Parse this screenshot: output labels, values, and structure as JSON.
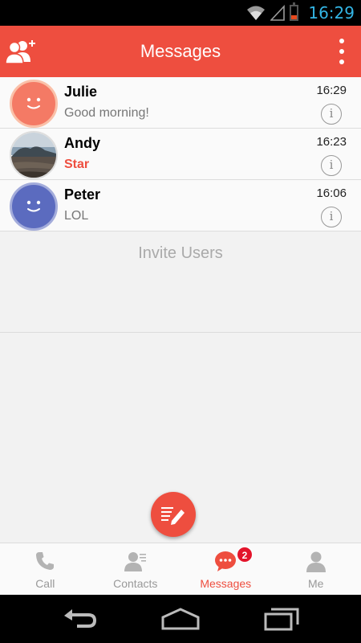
{
  "status_bar": {
    "time": "16:29",
    "icons": [
      "wifi-icon",
      "signal-icon",
      "battery-icon"
    ]
  },
  "app_bar": {
    "title": "Messages",
    "left_icon": "add-user-icon",
    "right_icon": "overflow-menu-icon"
  },
  "conversations": [
    {
      "name": "Julie",
      "preview": "Good morning!",
      "time": "16:29",
      "avatar": "smiley-avatar-orange",
      "highlight": false
    },
    {
      "name": "Andy",
      "preview": "Star",
      "time": "16:23",
      "avatar": "photo-avatar",
      "highlight": true
    },
    {
      "name": "Peter",
      "preview": "LOL",
      "time": "16:06",
      "avatar": "smiley-avatar-blue",
      "highlight": false
    }
  ],
  "info_glyph": "i",
  "invite_label": "Invite Users",
  "compose_icon": "compose-icon",
  "tabs": [
    {
      "label": "Call",
      "icon": "phone-icon",
      "active": false
    },
    {
      "label": "Contacts",
      "icon": "contacts-icon",
      "active": false
    },
    {
      "label": "Messages",
      "icon": "chat-bubble-icon",
      "active": true,
      "badge": "2"
    },
    {
      "label": "Me",
      "icon": "person-icon",
      "active": false
    }
  ],
  "nav_bar": [
    "back-icon",
    "home-icon",
    "recents-icon"
  ],
  "colors": {
    "accent": "#ee4e3f",
    "clock": "#33b5e5",
    "badge": "#e3142b"
  }
}
